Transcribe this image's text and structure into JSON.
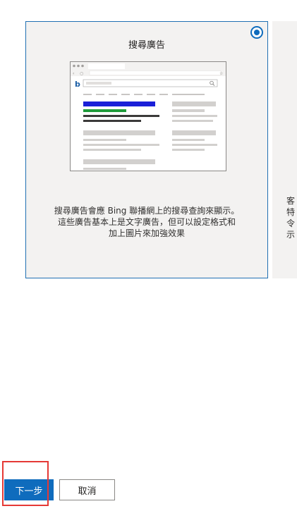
{
  "card_selected": {
    "title": "搜尋廣告",
    "description_lines": [
      "搜尋廣告會應 Bing 聯播網上的搜尋查詢來顯示。",
      "這些廣告基本上是文字廣告，但可以設定格式和",
      "加上圖片來加強效果"
    ],
    "selected": true
  },
  "card_partial": {
    "text_lines": [
      "客",
      "特",
      "令",
      "示"
    ]
  },
  "footer": {
    "next_label": "下一步",
    "cancel_label": "取消"
  },
  "colors": {
    "accent": "#0f6cbd",
    "highlight_border": "#e53935",
    "card_bg": "#f3f2f1",
    "card_border": "#1f6fb2"
  }
}
